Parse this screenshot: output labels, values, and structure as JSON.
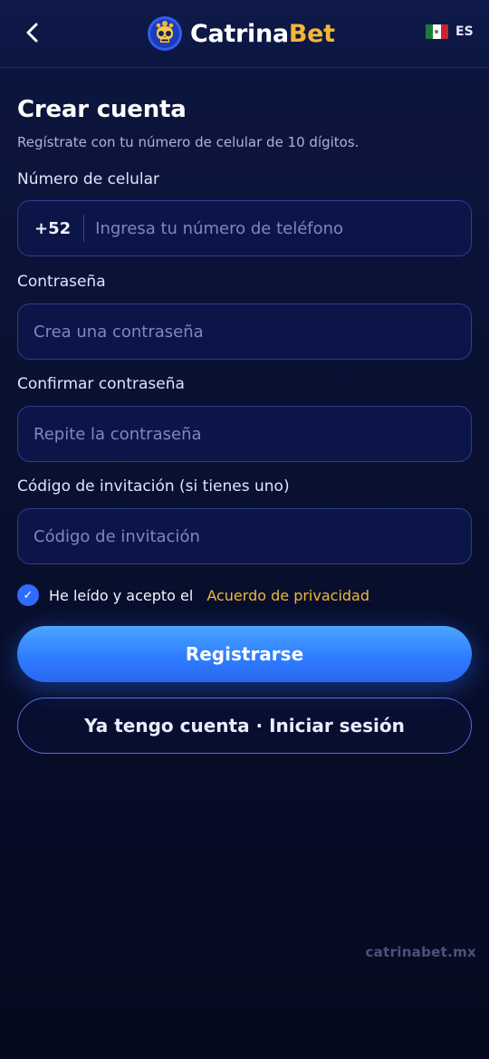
{
  "header": {
    "back_icon": "chevron-left-icon",
    "brand_part1": "Catrina",
    "brand_part2": "Bet",
    "brand_colors": {
      "primary": "#ffffff",
      "accent": "#f2b737"
    },
    "lang_flag": "mexico-flag-icon",
    "lang_label": "ES"
  },
  "form": {
    "title": "Crear cuenta",
    "subtitle": "Regístrate con tu número de celular de 10 dígitos.",
    "phone": {
      "label": "Número de celular",
      "prefix": "+52",
      "placeholder": "Ingresa tu número de teléfono",
      "value": ""
    },
    "password": {
      "label": "Contraseña",
      "placeholder": "Crea una contraseña",
      "value": ""
    },
    "confirm_password": {
      "label": "Confirmar contraseña",
      "placeholder": "Repite la contraseña",
      "value": ""
    },
    "invite_code": {
      "label": "Código de invitación (si tienes uno)",
      "placeholder": "Código de invitación",
      "value": ""
    },
    "agree": {
      "checked": true,
      "check_glyph": "✓",
      "text": "He leído y acepto el",
      "link": "Acuerdo de privacidad"
    },
    "register_button": "Registrarse",
    "login_button": "Ya tengo cuenta · Iniciar sesión"
  },
  "footer": {
    "watermark": "catrinabet.mx"
  },
  "colors": {
    "accent_gold": "#f2b737",
    "primary_blue": "#2f7dff",
    "background": "#0a1235"
  }
}
